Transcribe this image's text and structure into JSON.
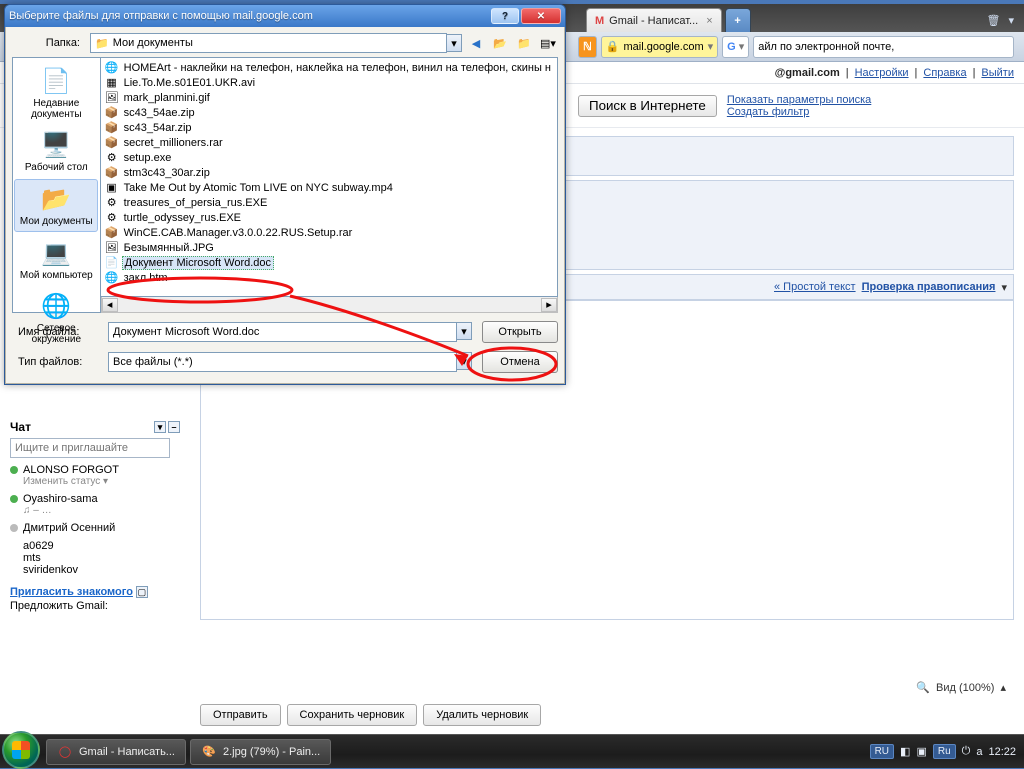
{
  "browser": {
    "tab_label": "Gmail - Написат...",
    "tab_icons": {
      "trash": "🗑",
      "menu": "▾"
    },
    "addr": {
      "rss_icon": "feed-icon",
      "lock_text": "mail.google.com",
      "g_icon": "G",
      "search_fragment": "айл по электронной почте,"
    },
    "gm_head": {
      "mail": "@gmail.com",
      "settings": "Настройки",
      "help": "Справка",
      "logout": "Выйти"
    },
    "gm_row2": {
      "btn_web": "Поиск в Интернете",
      "link_opts": "Показать параметры поиска",
      "link_filter": "Создать фильтр"
    },
    "toolbar": {
      "quote": "❝",
      "align_l": "≡",
      "align_c": "≡",
      "align_r": "≡",
      "align_j": "≡",
      "clear": "𝔗",
      "plain": "« Простой текст",
      "spell": "Проверка правописания",
      "tri": "▾"
    },
    "footer": {
      "send": "Отправить",
      "save": "Сохранить черновик",
      "discard": "Удалить черновик"
    },
    "view_label": "Вид (100%)",
    "popout": "⤢"
  },
  "sidebar": {
    "chat": "Чат",
    "search_ph": "Ищите и приглашайте",
    "c1": "ALONSO FORGOT",
    "c1_sub": "Изменить статус     ▾",
    "c2": "Oyashiro-sama",
    "c2_sub": "♫ – …",
    "c3": "Дмитрий Осенний",
    "lab1": "a0629",
    "lab2": "mts",
    "lab3": "sviridenkov",
    "inv": "Пригласить знакомого",
    "gm": "Предложить Gmail:"
  },
  "dialog": {
    "title": "Выберите файлы для отправки с помощью mail.google.com",
    "folder_label": "Папка:",
    "folder_value": "Мои документы",
    "places": {
      "recent": "Недавние документы",
      "desktop": "Рабочий стол",
      "mydocs": "Мои документы",
      "mycomp": "Мой компьютер",
      "network": "Сетевое окружение"
    },
    "files": [
      "HOMEArt - наклейки на телефон, наклейка на телефон, винил на телефон, скины н",
      "Lie.To.Me.s01E01.UKR.avi",
      "mark_planmini.gif",
      "sc43_54ae.zip",
      "sc43_54ar.zip",
      "secret_millioners.rar",
      "setup.exe",
      "stm3c43_30ar.zip",
      "Take Me Out by Atomic Tom LIVE on NYC subway.mp4",
      "treasures_of_persia_rus.EXE",
      "turtle_odyssey_rus.EXE",
      "WinCE.CAB.Manager.v3.0.0.22.RUS.Setup.rar",
      "Безымянный.JPG",
      "Документ Microsoft Word.doc",
      "закл.htm"
    ],
    "file_icons": [
      "🌐",
      "▦",
      "🖼",
      "📦",
      "📦",
      "📦",
      "⚙",
      "📦",
      "▣",
      "⚙",
      "⚙",
      "📦",
      "🖼",
      "📄",
      "🌐"
    ],
    "selected_index": 13,
    "name_label": "Имя файла:",
    "name_value": "Документ Microsoft Word.doc",
    "type_label": "Тип файлов:",
    "type_value": "Все файлы (*.*)",
    "btn_open": "Открыть",
    "btn_cancel": "Отмена"
  },
  "taskbar": {
    "btn1": "Gmail - Написать...",
    "btn2": "2.jpg (79%) - Pain...",
    "lang1": "RU",
    "lang2": "Ru",
    "clock": "12:22"
  }
}
